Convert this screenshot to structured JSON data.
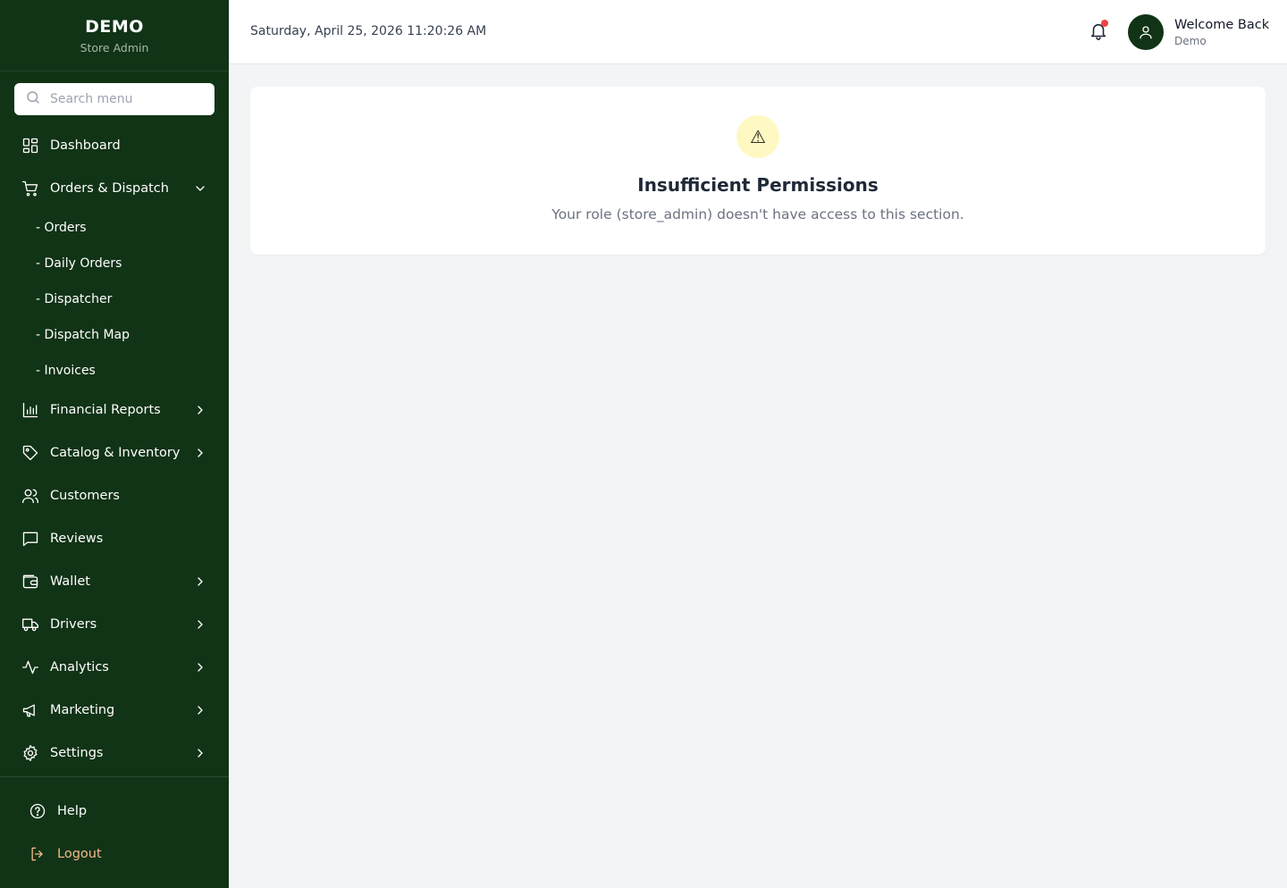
{
  "brand": {
    "title": "DEMO",
    "subtitle": "Store Admin"
  },
  "search": {
    "placeholder": "Search menu"
  },
  "nav": {
    "dashboard": "Dashboard",
    "orders_dispatch": "Orders & Dispatch",
    "orders_sub": [
      "- Orders",
      "- Daily Orders",
      "- Dispatcher",
      "- Dispatch Map",
      "- Invoices"
    ],
    "financial_reports": "Financial Reports",
    "catalog_inventory": "Catalog & Inventory",
    "customers": "Customers",
    "reviews": "Reviews",
    "wallet": "Wallet",
    "drivers": "Drivers",
    "analytics": "Analytics",
    "marketing": "Marketing",
    "settings": "Settings"
  },
  "footer": {
    "help": "Help",
    "logout": "Logout"
  },
  "header": {
    "datetime": "Saturday, April 25, 2026 11:20:26 AM",
    "welcome": "Welcome Back",
    "user": "Demo"
  },
  "main": {
    "warning_symbol": "⚠",
    "title": "Insufficient Permissions",
    "message": "Your role (store_admin) doesn't have access to this section."
  },
  "colors": {
    "sidebar_bg": "#113316",
    "logout_text": "#f0b98a",
    "warning_bg": "#fef9c3",
    "notification_dot": "#ef4444"
  }
}
